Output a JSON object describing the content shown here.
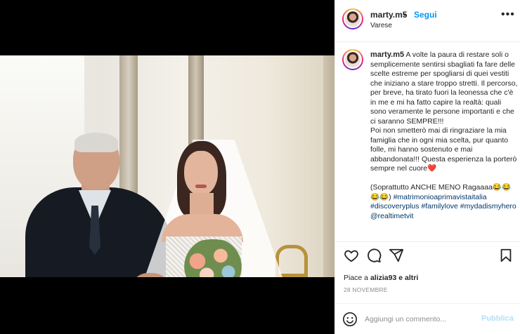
{
  "post": {
    "username": "marty.m5",
    "follow_label": "Segui",
    "separator": "•",
    "location": "Varese",
    "more_icon": "more-horizontal-icon",
    "caption": {
      "username": "marty.m5",
      "body": " A volte la paura di restare soli o semplicemente sentirsi sbagliati fa fare delle scelte estreme per spogliarsi di quei vestiti che iniziano a stare troppo stretti. Il percorso, per breve, ha tirato fuori la leonessa che c'è in me e mi ha fatto capire la realtà: quali sono veramente le persone importanti e che ci saranno SEMPRE!!!\nPoi non smetterò mai di ringraziare la mia famiglia che in ogni mia scelta, pur quanto folle, mi hanno sostenuto e mai abbandonata!!! Questa esperienza la porterò sempre nel cuore❤️\n\n(Soprattutto ANCHE MENO Ragaaaa😂😂😂😂) ",
      "hashtags": "#matrimonioaprimavistaitalia #discoveryplus #familylove #mydadismyhero @realtimetvit"
    },
    "likes": {
      "prefix": "Piace a ",
      "user": "alizia93",
      "suffix": " e altri"
    },
    "date": "28 NOVEMBRE",
    "comment": {
      "placeholder": "Aggiungi un commento...",
      "publish_label": "Pubblica"
    }
  },
  "colors": {
    "accent": "#0095f6",
    "publish_disabled": "#b2dffc",
    "hashtag": "#00376b",
    "muted": "#8e8e8e"
  }
}
